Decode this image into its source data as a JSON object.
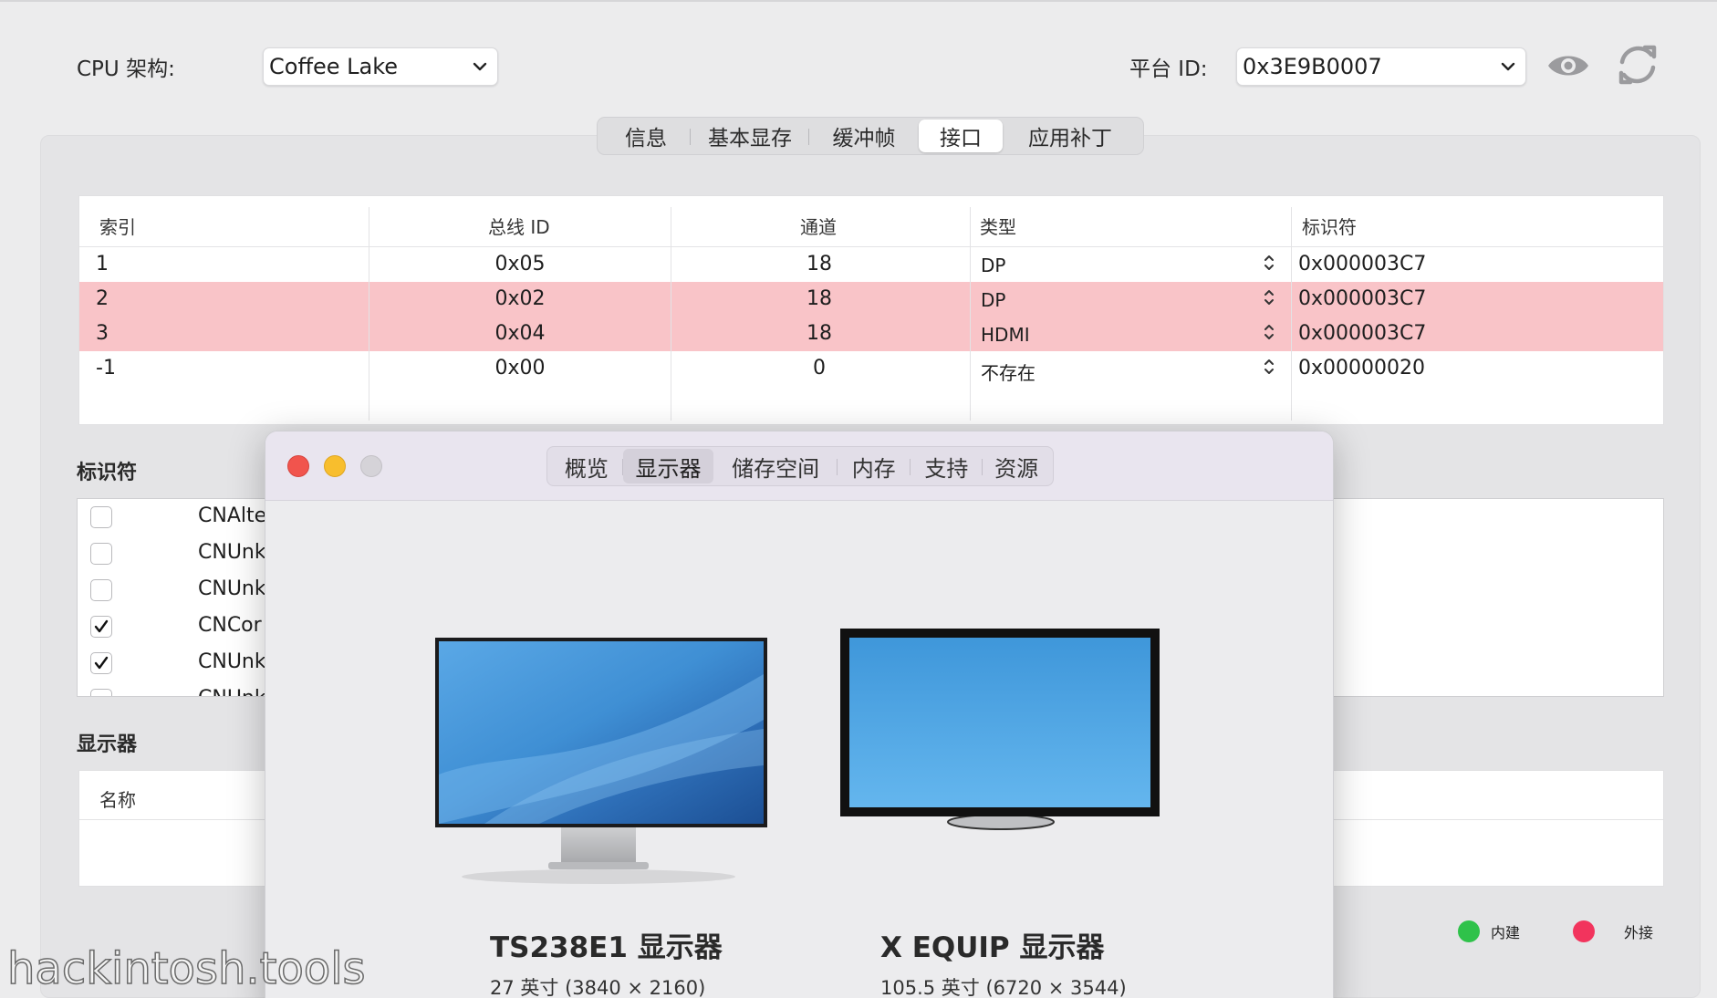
{
  "toolbar": {
    "cpu_label": "CPU 架构:",
    "cpu_value": "Coffee Lake",
    "platform_label": "平台 ID:",
    "platform_value": "0x3E9B0007"
  },
  "tabs": [
    {
      "label": "信息",
      "active": false
    },
    {
      "label": "基本显存",
      "active": false
    },
    {
      "label": "缓冲帧",
      "active": false
    },
    {
      "label": "接口",
      "active": true
    },
    {
      "label": "应用补丁",
      "active": false
    }
  ],
  "ports": {
    "headers": [
      "索引",
      "总线 ID",
      "通道",
      "类型",
      "标识符"
    ],
    "rows": [
      {
        "index": "1",
        "bus_id": "0x05",
        "pipe": "18",
        "type": "DP",
        "flags": "0x000003C7",
        "highlight": false
      },
      {
        "index": "2",
        "bus_id": "0x02",
        "pipe": "18",
        "type": "DP",
        "flags": "0x000003C7",
        "highlight": true
      },
      {
        "index": "3",
        "bus_id": "0x04",
        "pipe": "18",
        "type": "HDMI",
        "flags": "0x000003C7",
        "highlight": true
      },
      {
        "index": "-1",
        "bus_id": "0x00",
        "pipe": "0",
        "type": "不存在",
        "flags": "0x00000020",
        "highlight": false
      }
    ]
  },
  "identifiers": {
    "title": "标识符",
    "items": [
      {
        "label": "CNAlte",
        "checked": false
      },
      {
        "label": "CNUnk",
        "checked": false
      },
      {
        "label": "CNUnk",
        "checked": false
      },
      {
        "label": "CNCor",
        "checked": true
      },
      {
        "label": "CNUnk",
        "checked": true
      },
      {
        "label": "CNUnk",
        "checked": false
      }
    ]
  },
  "displays": {
    "title": "显示器",
    "name_header": "名称"
  },
  "legend": {
    "builtin": "内建",
    "external": "外接",
    "builtin_color": "#2fc24a",
    "external_color": "#f2345d"
  },
  "about_window": {
    "tabs": [
      {
        "label": "概览",
        "active": false
      },
      {
        "label": "显示器",
        "active": true
      },
      {
        "label": "储存空间",
        "active": false
      },
      {
        "label": "内存",
        "active": false
      },
      {
        "label": "支持",
        "active": false
      },
      {
        "label": "资源",
        "active": false
      }
    ],
    "monitors": [
      {
        "name": "TS238E1 显示器",
        "spec": "27 英寸 (3840 × 2160)",
        "icon": "monitor-with-stand-icon"
      },
      {
        "name": "X EQUIP 显示器",
        "spec": "105.5 英寸 (6720 × 3544)",
        "icon": "tv-display-icon"
      }
    ]
  },
  "watermark": "hackintosh.tools"
}
